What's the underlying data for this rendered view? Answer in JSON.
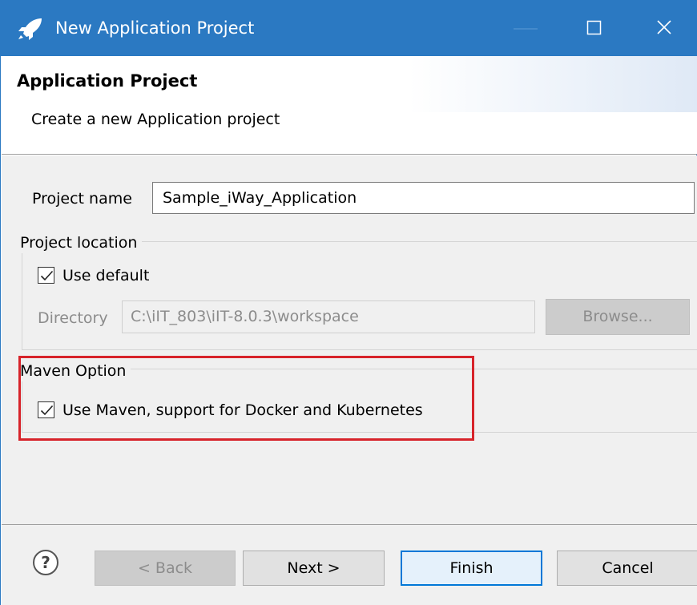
{
  "window": {
    "title": "New Application Project",
    "icon": "rocket-icon",
    "controls": [
      "minimize-icon",
      "maximize-icon",
      "close-icon"
    ]
  },
  "header": {
    "title": "Application Project",
    "description": "Create a new Application project"
  },
  "form": {
    "project_name_label": "Project name",
    "project_name_value": "Sample_iWay_Application",
    "location_group_label": "Project location",
    "use_default_label": "Use default",
    "use_default_checked": true,
    "directory_label": "Directory",
    "directory_value": "C:\\iIT_803\\iIT-8.0.3\\workspace",
    "browse_label": "Browse...",
    "maven_group_label": "Maven Option",
    "maven_label": "Use Maven, support for Docker and Kubernetes",
    "maven_checked": true
  },
  "footer": {
    "help_icon": "help-icon",
    "back_label": "< Back",
    "next_label": "Next >",
    "finish_label": "Finish",
    "cancel_label": "Cancel"
  },
  "colors": {
    "titlebar": "#2b79c2",
    "highlight": "#d7232a",
    "default_button_border": "#0078d7"
  }
}
